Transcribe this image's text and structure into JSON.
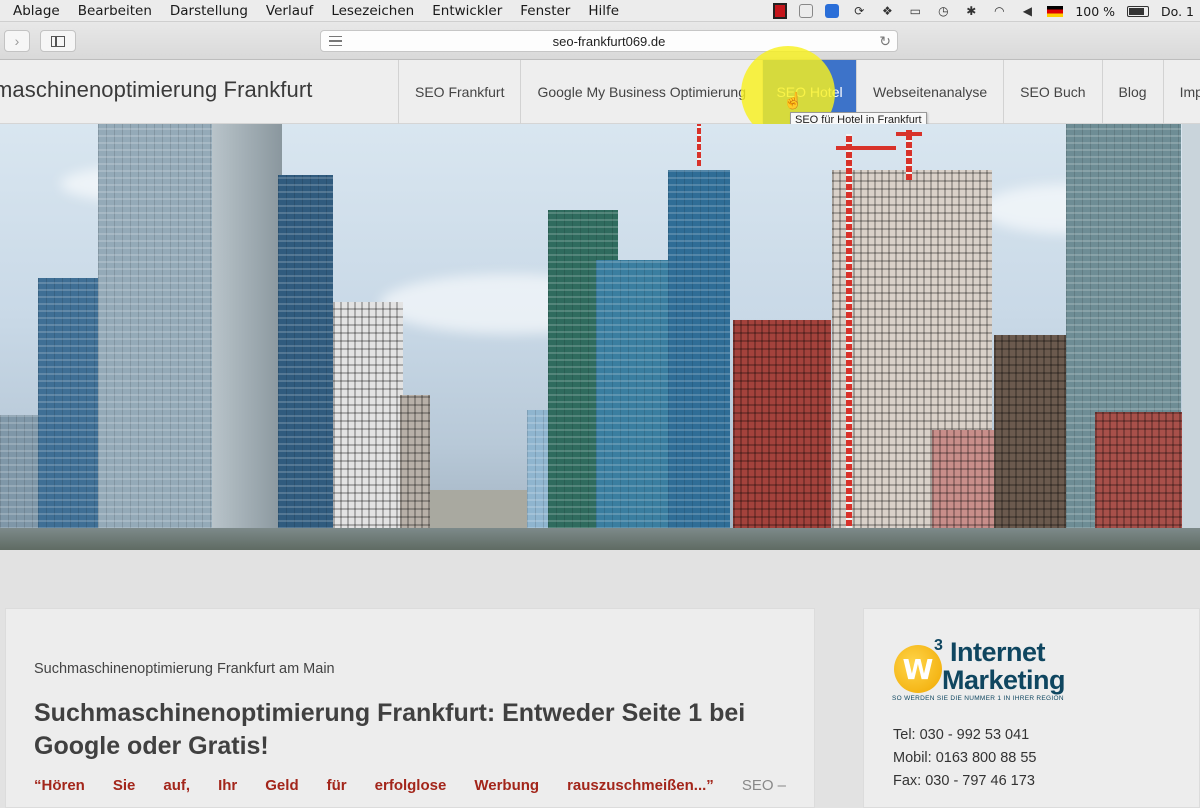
{
  "menubar": {
    "items": [
      "Ablage",
      "Bearbeiten",
      "Darstellung",
      "Verlauf",
      "Lesezeichen",
      "Entwickler",
      "Fenster",
      "Hilfe"
    ],
    "battery": "100 %",
    "clock": "Do. 1"
  },
  "browser": {
    "url": "seo-frankfurt069.de"
  },
  "site": {
    "title": "maschinenoptimierung Frankfurt",
    "nav": [
      "SEO Frankfurt",
      "Google My Business Optimierung",
      "SEO Hotel",
      "Webseitenanalyse",
      "SEO Buch",
      "Blog",
      "Impress"
    ],
    "active_nav": "SEO Hotel",
    "tooltip": "SEO für Hotel in Frankfurt"
  },
  "article": {
    "breadcrumb": "Suchmaschinenoptimierung Frankfurt am Main",
    "title": "Suchmaschinenoptimierung Frankfurt: Entweder Seite 1 bei Google oder Gratis!",
    "quote_words": [
      "“Hören",
      "Sie",
      "auf,",
      "Ihr",
      "Geld",
      "für",
      "erfolglose",
      "Werbung",
      "rauszuschmeißen...”"
    ],
    "quote_tail": "SEO –"
  },
  "sidebar": {
    "logo": {
      "letter": "W",
      "superscript": "3",
      "word1": "Internet",
      "word2": "Marketing",
      "slogan": "SO WERDEN SIE DIE NUMMER 1 IN IHRER REGION"
    },
    "contact": {
      "tel": "Tel: 030 - 992 53 041",
      "mobil": "Mobil: 0163 800 88 55",
      "fax": "Fax: 030 - 797 46 173"
    }
  },
  "colors": {
    "nav_active": "#3d73c9",
    "quote": "#a3261b",
    "logo_blue": "#0f4660",
    "logo_gold": "#f0a800"
  }
}
